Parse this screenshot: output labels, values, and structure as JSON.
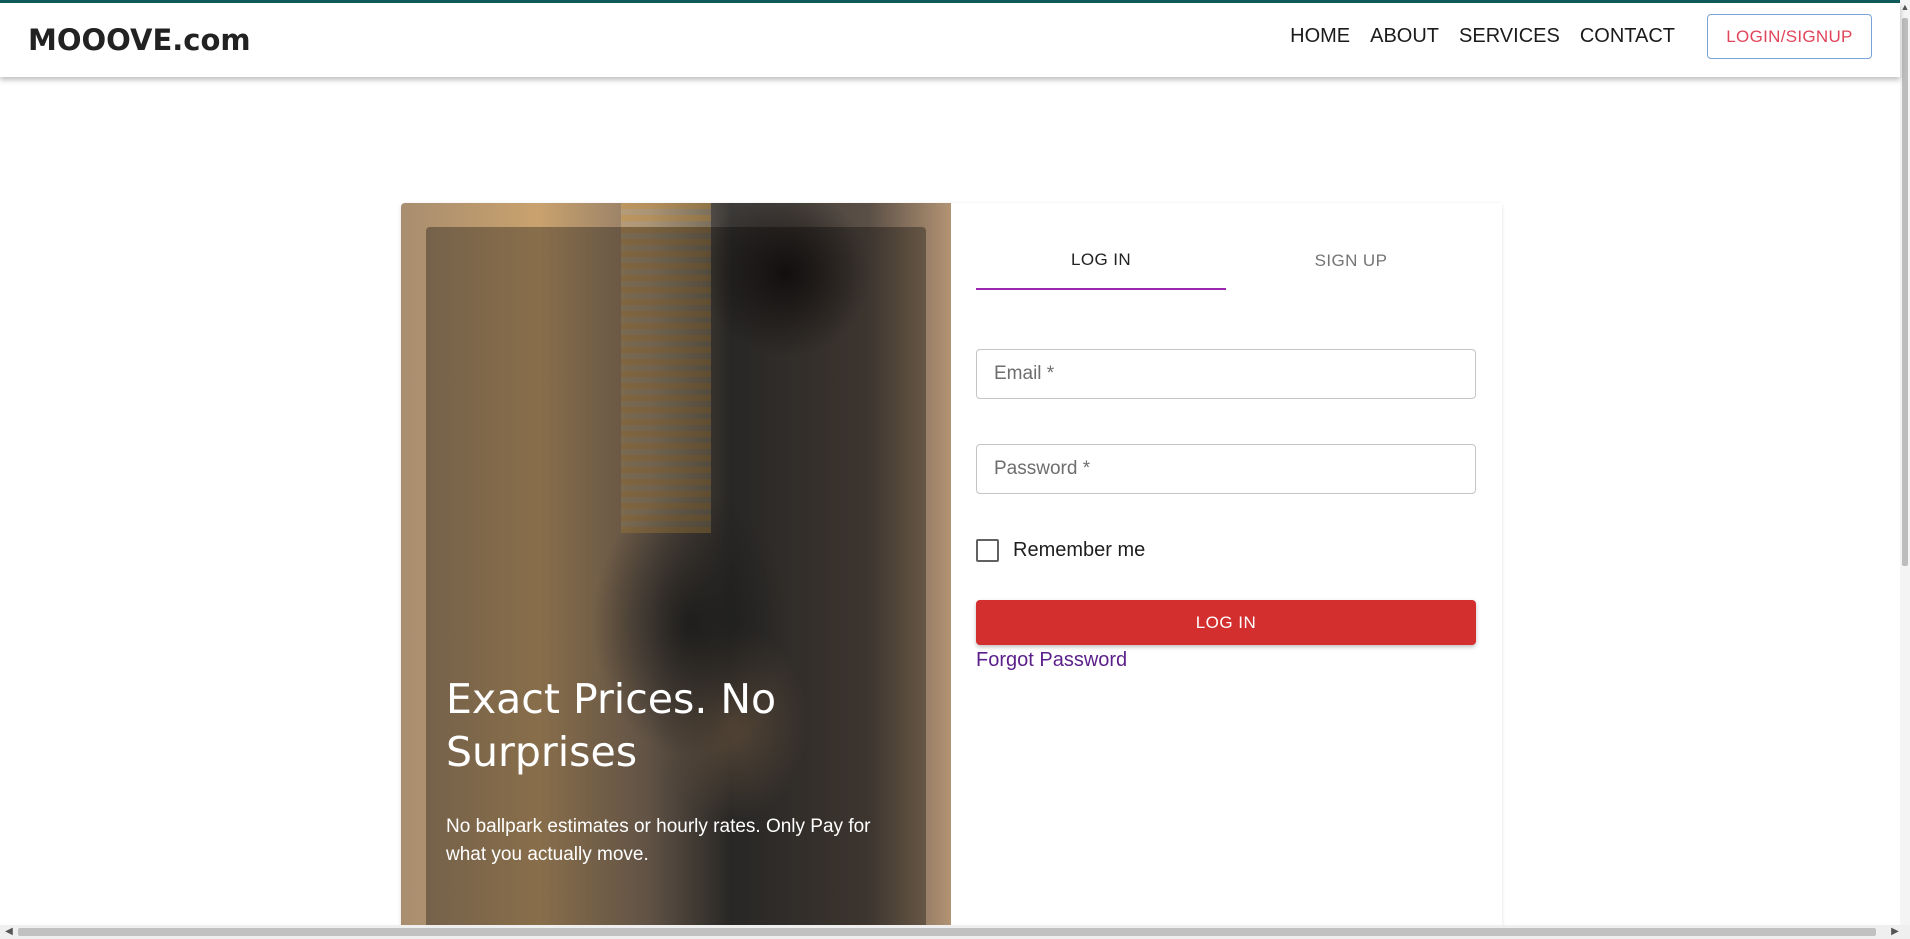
{
  "header": {
    "brand": "MOOOVE.com",
    "nav": [
      "HOME",
      "ABOUT",
      "SERVICES",
      "CONTACT"
    ],
    "login_signup_label": "LOGIN/SIGNUP"
  },
  "hero": {
    "title": "Exact Prices. No Surprises",
    "text": "No ballpark estimates or hourly rates. Only Pay for what you actually move."
  },
  "tabs": {
    "login": "LOG IN",
    "signup": "SIGN UP"
  },
  "form": {
    "email_placeholder": "Email *",
    "password_placeholder": "Password *",
    "remember_label": "Remember me",
    "login_button": "LOG IN",
    "forgot_password": "Forgot Password"
  },
  "colors": {
    "accent_top": "#0f5c5a",
    "primary_red": "#d32f2f",
    "tab_indicator": "#9c27b0",
    "link_purple": "#5a1f8a",
    "login_signup_text": "#e0455a"
  }
}
